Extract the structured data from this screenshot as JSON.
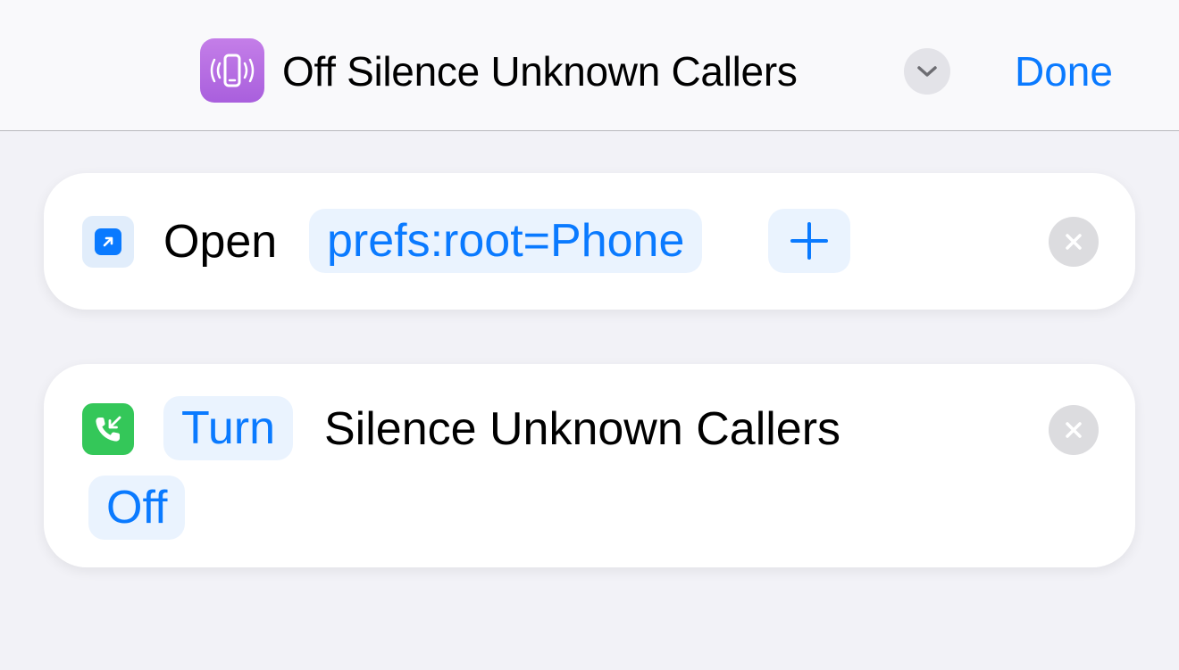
{
  "header": {
    "title": "Off Silence Unknown Callers",
    "done_label": "Done",
    "app_icon": "phone-vibrate-icon",
    "icon_color": "#b06ae0"
  },
  "actions": [
    {
      "icon": "open-url-icon",
      "verb": "Open",
      "url_token": "prefs:root=Phone",
      "add_icon": "plus-icon",
      "remove_icon": "close-icon"
    },
    {
      "icon": "phone-incoming-icon",
      "verb_token": "Turn",
      "setting": "Silence Unknown Callers",
      "state_token": "Off",
      "remove_icon": "close-icon"
    }
  ],
  "colors": {
    "accent": "#0a7aff",
    "token_bg": "#eaf3fe",
    "phone_green": "#34c759",
    "background": "#f2f2f7"
  }
}
